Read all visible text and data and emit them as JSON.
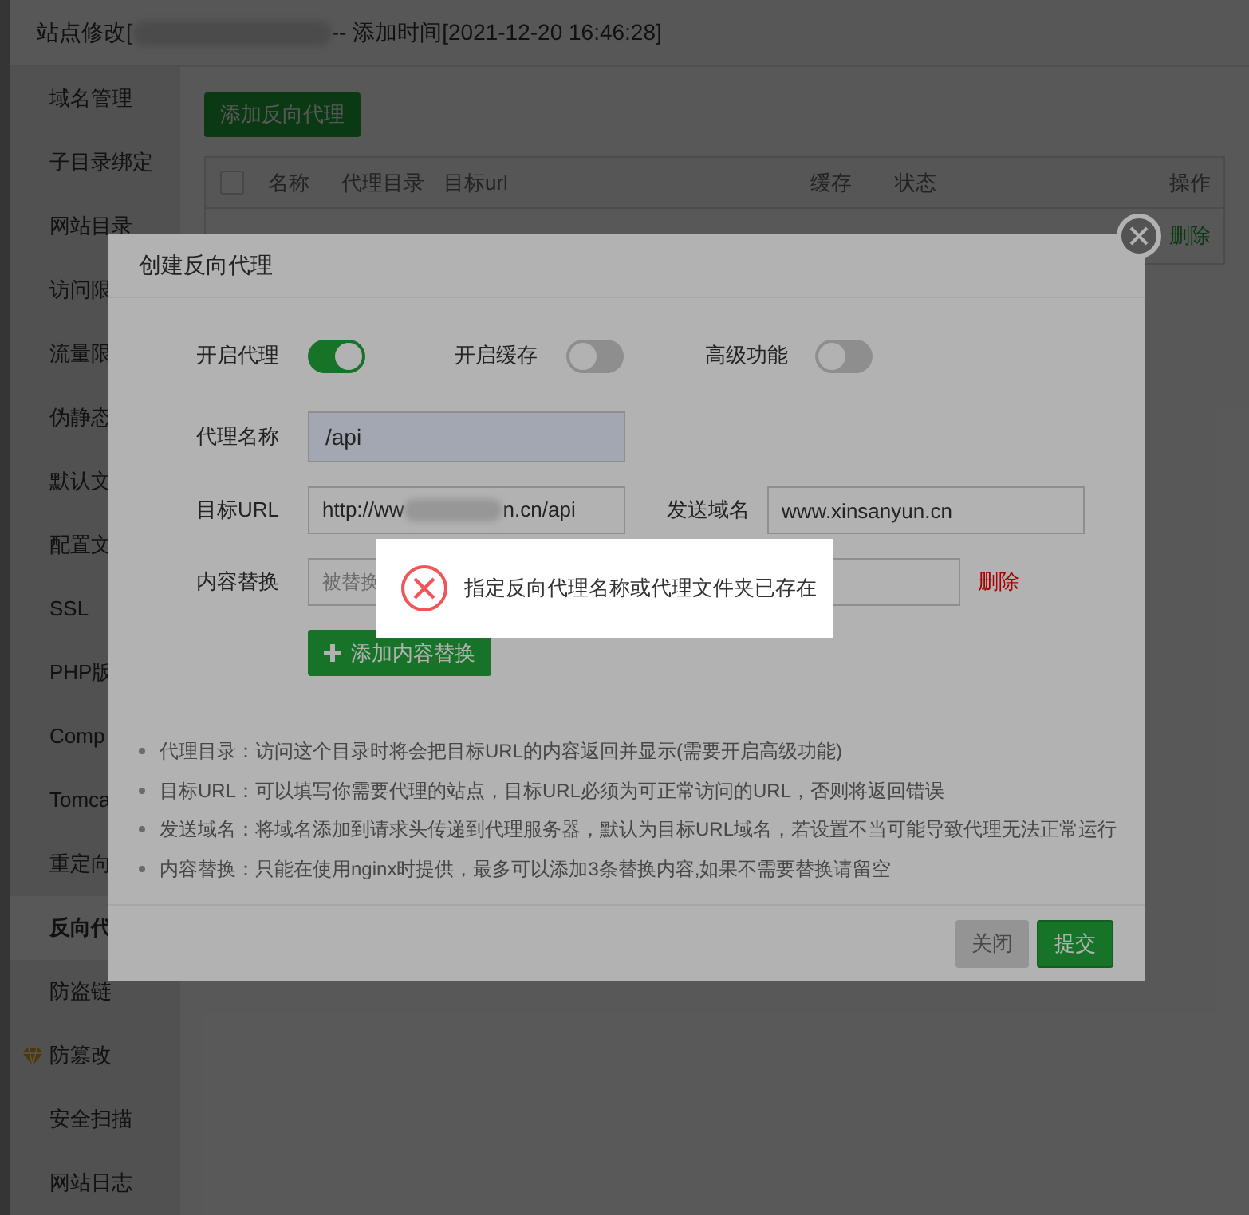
{
  "window": {
    "title_start": "站点修改[",
    "title_end": "-- 添加时间[2021-12-20 16:46:28]"
  },
  "sidebar": {
    "items": [
      {
        "label": "域名管理",
        "selected": false,
        "kind": "plain"
      },
      {
        "label": "子目录绑定",
        "selected": false,
        "kind": "plain"
      },
      {
        "label": "网站目录",
        "selected": false,
        "kind": "plain"
      },
      {
        "label": "访问限",
        "selected": false,
        "kind": "plain"
      },
      {
        "label": "流量限",
        "selected": false,
        "kind": "plain"
      },
      {
        "label": "伪静态",
        "selected": false,
        "kind": "plain"
      },
      {
        "label": "默认文",
        "selected": false,
        "kind": "plain"
      },
      {
        "label": "配置文",
        "selected": false,
        "kind": "plain"
      },
      {
        "label": "SSL",
        "selected": false,
        "kind": "plain"
      },
      {
        "label": "PHP版",
        "selected": false,
        "kind": "plain"
      },
      {
        "label": "Comp",
        "selected": false,
        "kind": "plain"
      },
      {
        "label": "Tomca",
        "selected": false,
        "kind": "plain"
      },
      {
        "label": "重定向",
        "selected": false,
        "kind": "plain"
      },
      {
        "label": "反向代",
        "selected": true,
        "kind": "plain"
      },
      {
        "label": "防盗链",
        "selected": false,
        "kind": "plain"
      },
      {
        "label": "防篡改",
        "selected": false,
        "kind": "premium"
      },
      {
        "label": "安全扫描",
        "selected": false,
        "kind": "plain"
      },
      {
        "label": "网站日志",
        "selected": false,
        "kind": "plain"
      }
    ]
  },
  "add_button": "添加反向代理",
  "table": {
    "select_all": {
      "checked": false
    },
    "columns": [
      "名称",
      "代理目录",
      "目标url",
      "缓存",
      "状态",
      "操作"
    ],
    "rows": [
      {
        "action": "删除"
      }
    ]
  },
  "dialog": {
    "title": "创建反向代理",
    "toggles": [
      {
        "label": "开启代理",
        "on": true
      },
      {
        "label": "开启缓存",
        "on": false
      },
      {
        "label": "高级功能",
        "on": false
      }
    ],
    "proxy_name": {
      "label": "代理名称",
      "value": "/api"
    },
    "target_url": {
      "label": "目标URL",
      "value_start": "http://ww",
      "value_end": "n.cn/api"
    },
    "send_domain": {
      "label": "发送域名",
      "value": "www.xinsanyun.cn"
    },
    "content_replace": {
      "label": "内容替换",
      "placeholder": "被替换",
      "delete": "删除",
      "add_button": "添加内容替换"
    },
    "notes": [
      "代理目录：访问这个目录时将会把目标URL的内容返回并显示(需要开启高级功能)",
      "目标URL：可以填写你需要代理的站点，目标URL必须为可正常访问的URL，否则将返回错误",
      "发送域名：将域名添加到请求头传递到代理服务器，默认为目标URL域名，若设置不当可能导致代理无法正常运行",
      "内容替换：只能在使用nginx时提供，最多可以添加3条替换内容,如果不需要替换请留空"
    ],
    "buttons": [
      {
        "label": "关闭",
        "disabled": true
      },
      {
        "label": "提交",
        "disabled": false
      }
    ]
  },
  "toast": {
    "kind": "error",
    "message": "指定反向代理名称或代理文件夹已存在"
  }
}
